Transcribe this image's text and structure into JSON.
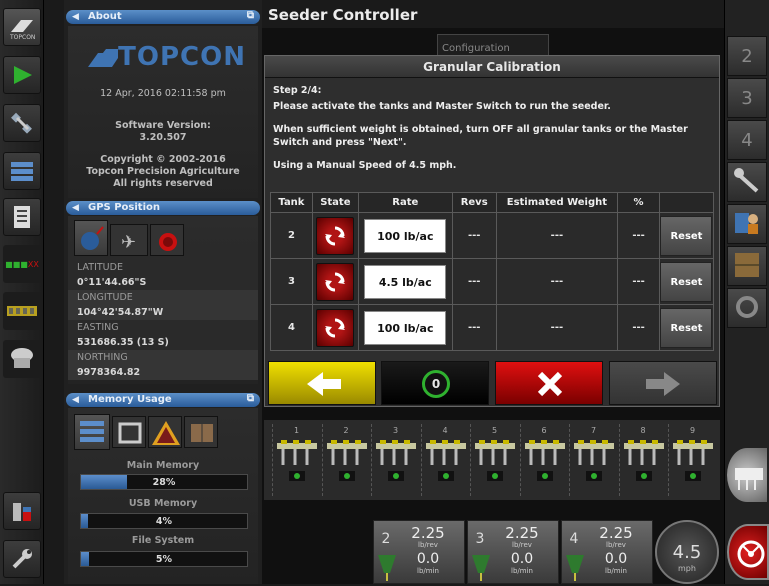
{
  "title": "Seeder Controller",
  "about": {
    "header": "About",
    "logo": "TOPCON",
    "datetime": "12 Apr, 2016  02:11:58 pm",
    "sw_label": "Software Version:",
    "sw_version": "3.20.507",
    "copyright": "Copyright © 2002-2016",
    "company": "Topcon Precision Agriculture",
    "rights": "All rights reserved"
  },
  "gps": {
    "header": "GPS Position",
    "fields": [
      {
        "label": "LATITUDE",
        "value": "0°11'44.66\"S"
      },
      {
        "label": "LONGITUDE",
        "value": "104°42'54.87\"W"
      },
      {
        "label": "EASTING",
        "value": "531686.35 (13 S)"
      },
      {
        "label": "NORTHING",
        "value": "9978364.82"
      }
    ]
  },
  "memory": {
    "header": "Memory Usage",
    "items": [
      {
        "label": "Main Memory",
        "value": "28%",
        "fraction": 0.28
      },
      {
        "label": "USB Memory",
        "value": "4%",
        "fraction": 0.04
      },
      {
        "label": "File System",
        "value": "5%",
        "fraction": 0.05
      }
    ]
  },
  "configuration_tab": "Configuration",
  "dialog": {
    "title": "Granular Calibration",
    "step": "Step 2/4:",
    "line1": "Please activate the tanks and Master Switch to run the seeder.",
    "line2": "When sufficient weight is obtained, turn OFF all granular tanks or the Master",
    "line3": "Switch and press \"Next\".",
    "line4": "Using a Manual Speed of 4.5 mph.",
    "columns": [
      "Tank",
      "State",
      "Rate",
      "Revs",
      "Estimated Weight",
      "%",
      ""
    ],
    "rows": [
      {
        "tank": "2",
        "rate": "100 lb/ac",
        "revs": "---",
        "weight": "---",
        "pct": "---",
        "reset": "Reset"
      },
      {
        "tank": "3",
        "rate": "4.5 lb/ac",
        "revs": "---",
        "weight": "---",
        "pct": "---",
        "reset": "Reset"
      },
      {
        "tank": "4",
        "rate": "100 lb/ac",
        "revs": "---",
        "weight": "---",
        "pct": "---",
        "reset": "Reset"
      }
    ],
    "zero_label": "0"
  },
  "right_tabs": [
    "2",
    "3",
    "4"
  ],
  "rows_units": [
    "1",
    "2",
    "3",
    "4",
    "5",
    "6",
    "7",
    "8",
    "9"
  ],
  "bottom": {
    "tanks": [
      {
        "num": "2",
        "rate": "2.25",
        "rate_unit": "lb/rev",
        "flow": "0.0",
        "flow_unit": "lb/min"
      },
      {
        "num": "3",
        "rate": "2.25",
        "rate_unit": "lb/rev",
        "flow": "0.0",
        "flow_unit": "lb/min"
      },
      {
        "num": "4",
        "rate": "2.25",
        "rate_unit": "lb/rev",
        "flow": "0.0",
        "flow_unit": "lb/min"
      }
    ],
    "speed": "4.5",
    "speed_unit": "mph"
  },
  "left_badge": "XX",
  "colors": {
    "accent_blue": "#3f74b3",
    "go_green": "#2fb12f",
    "cancel_red": "#c81010",
    "back_yellow": "#d6c400"
  }
}
